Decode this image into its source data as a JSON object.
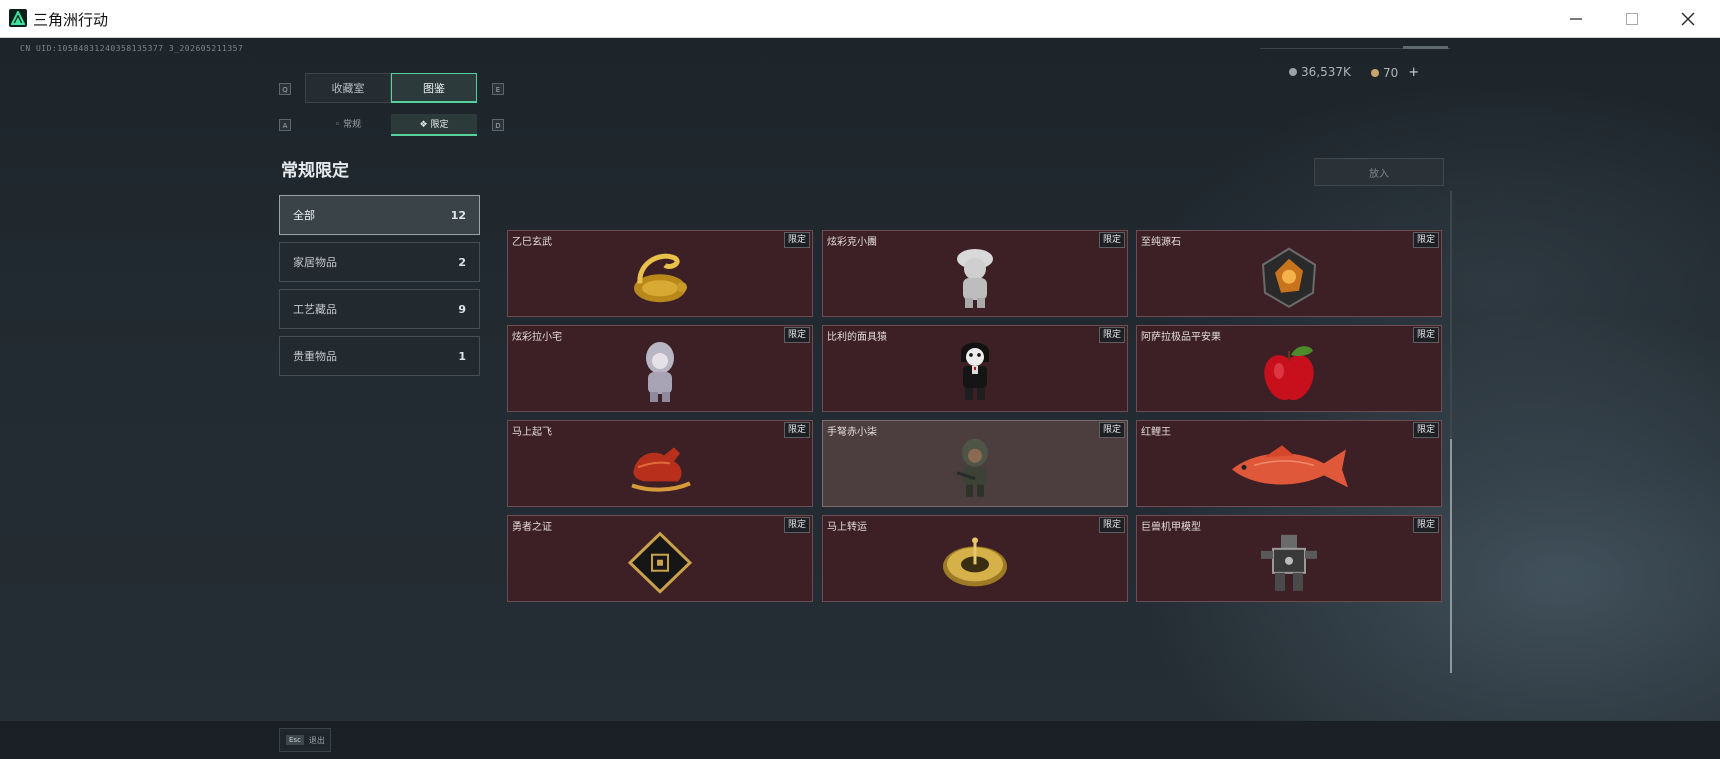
{
  "window": {
    "title": "三角洲行动",
    "minimize_icon": "minimize-icon",
    "maximize_icon": "maximize-icon",
    "close_icon": "close-icon"
  },
  "header": {
    "uid": "CN UID:10584831240358135377 3_202605211357",
    "currency": [
      {
        "icon": "silver-coin-icon",
        "value": "36,537K",
        "color": "#9aa3a8"
      },
      {
        "icon": "gold-coin-icon",
        "value": "70",
        "color": "#c9a56a",
        "plus": "+"
      }
    ]
  },
  "tabs": {
    "main": [
      {
        "key": "Q",
        "label": "收藏室",
        "active": false
      },
      {
        "label": "图鉴",
        "active": true,
        "key": "E"
      }
    ],
    "sub": [
      {
        "key": "A",
        "label": "常规",
        "active": false
      },
      {
        "label": "限定",
        "active": true,
        "key": "D"
      }
    ]
  },
  "section_title": "常规限定",
  "categories": [
    {
      "label": "全部",
      "count": "12",
      "active": true
    },
    {
      "label": "家居物品",
      "count": "2",
      "active": false
    },
    {
      "label": "工艺藏品",
      "count": "9",
      "active": false
    },
    {
      "label": "贵重物品",
      "count": "1",
      "active": false
    }
  ],
  "place_button": "放入",
  "items": [
    {
      "name": "乙巳玄武",
      "tag": "限定",
      "icon": "golden-snake-turtle-icon"
    },
    {
      "name": "炫彩克小團",
      "tag": "限定",
      "icon": "white-figurine-icon"
    },
    {
      "name": "至纯源石",
      "tag": "限定",
      "icon": "source-stone-icon"
    },
    {
      "name": "炫彩拉小宅",
      "tag": "限定",
      "icon": "hooded-figurine-icon"
    },
    {
      "name": "比利的面具猿",
      "tag": "限定",
      "icon": "masked-puppet-icon"
    },
    {
      "name": "阿萨拉极品平安果",
      "tag": "限定",
      "icon": "red-apple-icon"
    },
    {
      "name": "马上起飞",
      "tag": "限定",
      "icon": "red-horse-icon"
    },
    {
      "name": "手弩赤小柒",
      "tag": "限定",
      "icon": "crossbow-figurine-icon"
    },
    {
      "name": "红鲤王",
      "tag": "限定",
      "icon": "red-carp-icon"
    },
    {
      "name": "勇者之证",
      "tag": "限定",
      "icon": "badge-card-icon"
    },
    {
      "name": "马上转运",
      "tag": "限定",
      "icon": "golden-compass-icon"
    },
    {
      "name": "巨兽机甲模型",
      "tag": "限定",
      "icon": "mech-model-icon"
    }
  ],
  "footer": {
    "esc_key": "Esc",
    "esc_label": "退出"
  }
}
